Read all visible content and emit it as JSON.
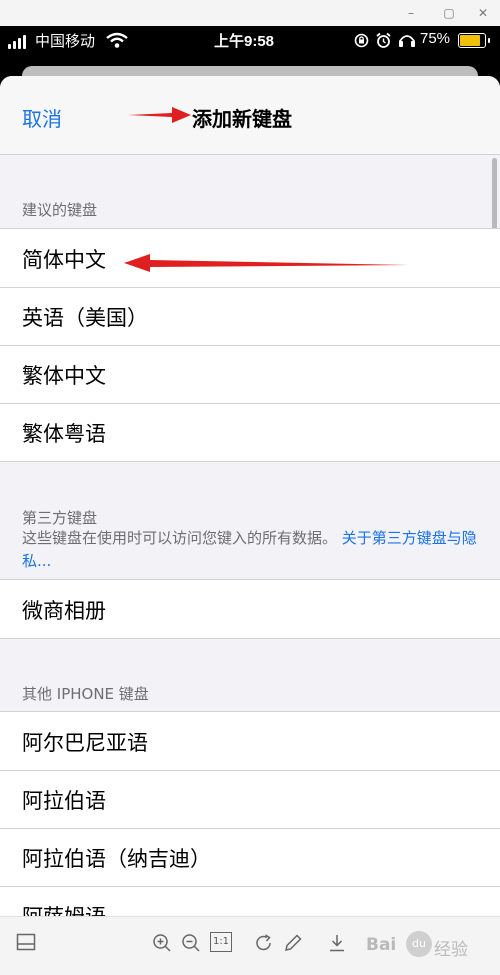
{
  "window": {
    "controls": {
      "minimize": "–",
      "maximize": "▢",
      "close": "✕"
    }
  },
  "status_bar": {
    "carrier": "中国移动",
    "time": "上午9:58",
    "battery_percent": "75%",
    "battery_level": 0.75,
    "battery_color": "#f2c00b"
  },
  "nav": {
    "cancel_label": "取消",
    "title": "添加新键盘"
  },
  "sections": {
    "suggested": {
      "header": "建议的键盘",
      "items": [
        "简体中文",
        "英语（美国）",
        "繁体中文",
        "繁体粤语"
      ]
    },
    "third_party": {
      "header": "第三方键盘",
      "footer_text": "这些键盘在使用时可以访问您键入的所有数据。",
      "footer_link": "关于第三方键盘与隐私...",
      "items": [
        "微商相册"
      ]
    },
    "other": {
      "header": "其他 IPHONE 键盘",
      "items": [
        "阿拉伯语",
        "阿拉伯语（纳吉迪）",
        "阿萨姆语"
      ],
      "first_item": "阿尔巴尼亚语"
    }
  },
  "toolbar": {
    "page_indicator": "1:1",
    "watermark_brand": "Bai",
    "watermark_paw": "du",
    "watermark_sub": "经验"
  },
  "colors": {
    "accent": "#1a73e8",
    "annotation": "#e02020"
  }
}
